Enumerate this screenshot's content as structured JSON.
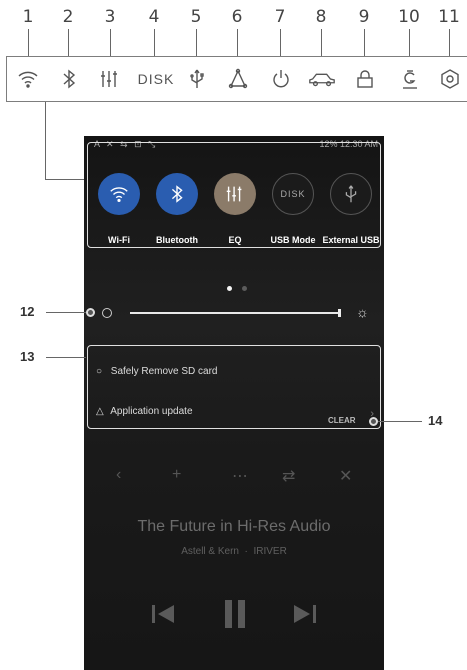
{
  "legend": {
    "numbers": [
      "1",
      "2",
      "3",
      "4",
      "5",
      "6",
      "7",
      "8",
      "9",
      "10",
      "11"
    ],
    "icons": [
      "wifi-icon",
      "bluetooth-icon",
      "eq-icon",
      "disk-text",
      "usb-icon",
      "sync-icon",
      "power-icon",
      "car-icon",
      "lock-icon",
      "gain-icon",
      "settings-icon"
    ],
    "disk_label": "DISK"
  },
  "status_bar": {
    "left": "A ✕ ⇆ ⊡ ⤡",
    "right": "12%  12:30 AM"
  },
  "quick_settings": [
    {
      "label": "Wi-Fi",
      "icon": "wifi-icon",
      "state": "on",
      "color": "#2a5db0"
    },
    {
      "label": "Bluetooth",
      "icon": "bluetooth-icon",
      "state": "on",
      "color": "#2a5db0"
    },
    {
      "label": "EQ",
      "icon": "eq-icon",
      "state": "on",
      "color": "#8b7b69"
    },
    {
      "label": "USB Mode",
      "icon": "disk-icon",
      "state": "off",
      "color": "#1b1b1b"
    },
    {
      "label": "External USB",
      "icon": "usb-icon",
      "state": "off",
      "color": "#1b1b1b"
    }
  ],
  "brightness": {
    "level_percent": 100
  },
  "notifications": [
    {
      "icon": "circle-icon",
      "text": "Safely Remove SD card"
    },
    {
      "icon": "triangle-icon",
      "text": "Application update"
    }
  ],
  "clear_label": "CLEAR",
  "player": {
    "title": "The Future in Hi-Res Audio",
    "artist": "Astell & Kern",
    "album": "IRIVER"
  },
  "callouts": {
    "c12": "12",
    "c13": "13",
    "c14": "14"
  }
}
